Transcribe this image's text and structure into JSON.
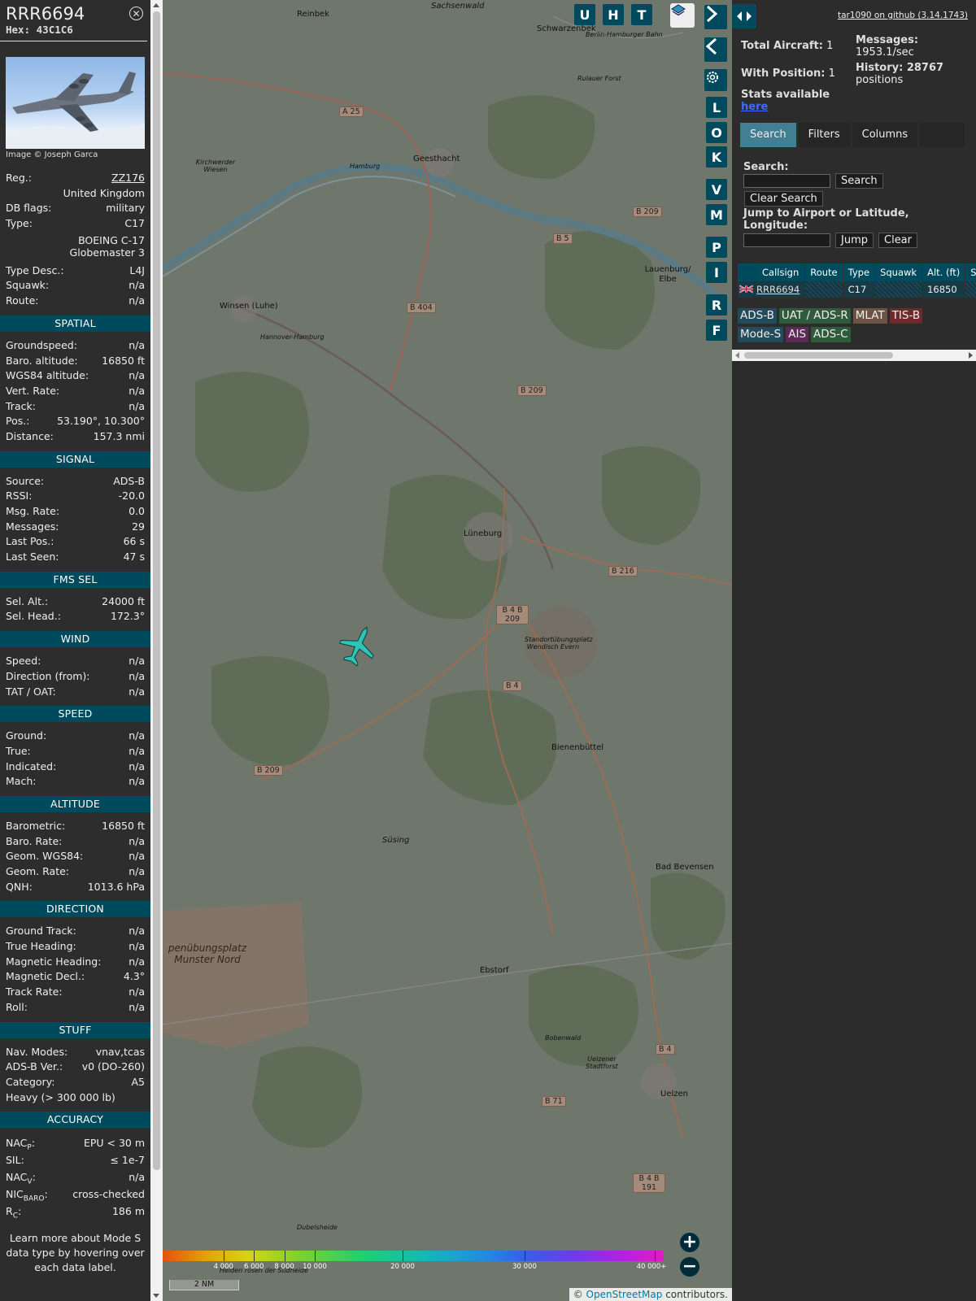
{
  "aircraft": {
    "callsign": "RRR6694",
    "hex_label": "Hex:",
    "hex": "43C1C6",
    "image_credit": "Image © Joseph Garca",
    "reg_label": "Reg.:",
    "reg": "ZZ176",
    "country": "United Kingdom",
    "dbflags_label": "DB flags:",
    "dbflags": "military",
    "type_label": "Type:",
    "type": "C17",
    "type_name_1": "BOEING C-17",
    "type_name_2": "Globemaster 3",
    "typedesc_label": "Type Desc.:",
    "typedesc": "L4J",
    "squawk_label": "Squawk:",
    "squawk": "n/a",
    "route_label": "Route:",
    "route": "n/a"
  },
  "sections": {
    "spatial": "SPATIAL",
    "signal": "SIGNAL",
    "fms": "FMS SEL",
    "wind": "WIND",
    "speed": "SPEED",
    "altitude": "ALTITUDE",
    "direction": "DIRECTION",
    "stuff": "STUFF",
    "accuracy": "ACCURACY"
  },
  "spatial": [
    {
      "label": "Groundspeed:",
      "value": "n/a"
    },
    {
      "label": "Baro. altitude:",
      "value": "16850 ft"
    },
    {
      "label": "WGS84 altitude:",
      "value": "n/a"
    },
    {
      "label": "Vert. Rate:",
      "value": "n/a"
    },
    {
      "label": "Track:",
      "value": "n/a"
    },
    {
      "label": "Pos.:",
      "value": "53.190°, 10.300°"
    },
    {
      "label": "Distance:",
      "value": "157.3 nmi"
    }
  ],
  "signal": [
    {
      "label": "Source:",
      "value": "ADS-B"
    },
    {
      "label": "RSSI:",
      "value": "-20.0"
    },
    {
      "label": "Msg. Rate:",
      "value": "0.0"
    },
    {
      "label": "Messages:",
      "value": "29"
    },
    {
      "label": "Last Pos.:",
      "value": "66 s"
    },
    {
      "label": "Last Seen:",
      "value": "47 s"
    }
  ],
  "fms": [
    {
      "label": "Sel. Alt.:",
      "value": "24000 ft"
    },
    {
      "label": "Sel. Head.:",
      "value": "172.3°"
    }
  ],
  "wind": [
    {
      "label": "Speed:",
      "value": "n/a"
    },
    {
      "label": "Direction (from):",
      "value": "n/a"
    },
    {
      "label": "TAT / OAT:",
      "value": "n/a"
    }
  ],
  "speed": [
    {
      "label": "Ground:",
      "value": "n/a"
    },
    {
      "label": "True:",
      "value": "n/a"
    },
    {
      "label": "Indicated:",
      "value": "n/a"
    },
    {
      "label": "Mach:",
      "value": "n/a"
    }
  ],
  "altitude": [
    {
      "label": "Barometric:",
      "value": "16850 ft"
    },
    {
      "label": "Baro. Rate:",
      "value": "n/a"
    },
    {
      "label": "Geom. WGS84:",
      "value": "n/a"
    },
    {
      "label": "Geom. Rate:",
      "value": "n/a"
    },
    {
      "label": "QNH:",
      "value": "1013.6 hPa"
    }
  ],
  "direction": [
    {
      "label": "Ground Track:",
      "value": "n/a"
    },
    {
      "label": "True Heading:",
      "value": "n/a"
    },
    {
      "label": "Magnetic Heading:",
      "value": "n/a"
    },
    {
      "label": "Magnetic Decl.:",
      "value": "4.3°"
    },
    {
      "label": "Track Rate:",
      "value": "n/a"
    },
    {
      "label": "Roll:",
      "value": "n/a"
    }
  ],
  "stuff": [
    {
      "label": "Nav. Modes:",
      "value": "vnav,tcas"
    },
    {
      "label": "ADS-B Ver.:",
      "value": "v0 (DO-260)"
    },
    {
      "label": "Category:",
      "value": "A5"
    },
    {
      "label": "Heavy (> 300 000 lb)",
      "value": ""
    }
  ],
  "accuracy": [
    {
      "label": "NAC",
      "sub": "P",
      "colon": ":",
      "value": "EPU < 30 m"
    },
    {
      "label": "SIL:",
      "sub": "",
      "colon": "",
      "value": "≤ 1e-7"
    },
    {
      "label": "NAC",
      "sub": "V",
      "colon": ":",
      "value": "n/a"
    },
    {
      "label": "NIC",
      "sub": "BARO",
      "colon": ":",
      "value": "cross-checked"
    },
    {
      "label": "R",
      "sub": "C",
      "colon": ":",
      "value": "186 m"
    }
  ],
  "footer_note": "Learn more about Mode S data type by hovering over each data label.",
  "map": {
    "buttons": [
      "U",
      "H",
      "T",
      "L",
      "O",
      "K",
      "V",
      "M",
      "P",
      "I",
      "R",
      "F"
    ],
    "places": [
      {
        "name": "Reinbek"
      },
      {
        "name": "Sachsenwald"
      },
      {
        "name": "Schwarzenbek"
      },
      {
        "name": "Berlin-Hamburger Bahn"
      },
      {
        "name": "Rulauer Forst"
      },
      {
        "name": "Geesthacht"
      },
      {
        "name": "Kirchwerder Wiesen"
      },
      {
        "name": "Hamburg"
      },
      {
        "name": "Lauenburg/ Elbe"
      },
      {
        "name": "Winsen (Luhe)"
      },
      {
        "name": "Hannover-Hamburg"
      },
      {
        "name": "Lüneburg"
      },
      {
        "name": "Standortübungsplatz Wendisch Evern"
      },
      {
        "name": "Bienenbüttel"
      },
      {
        "name": "Süsing"
      },
      {
        "name": "Bad Bevensen"
      },
      {
        "name": "penübungsplatz Munster Nord"
      },
      {
        "name": "Ebstorf"
      },
      {
        "name": "Bobenwald"
      },
      {
        "name": "Uelzener Stadtforst"
      },
      {
        "name": "Uelzen"
      },
      {
        "name": "Dubelsheide"
      },
      {
        "name": "Heiden rosen der Südheide"
      }
    ],
    "road_labels": [
      "A 25",
      "B 209",
      "B 5",
      "B 404",
      "B 209",
      "B 216",
      "B 4 B 209",
      "B 4",
      "B 209",
      "B 4",
      "B 71",
      "B 4 B 191"
    ],
    "altitude_scale": [
      "4 000",
      "6 000",
      "8 000",
      "10 000",
      "20 000",
      "30 000",
      "40 000+"
    ],
    "altitude_scale_values": [
      4000,
      6000,
      8000,
      10000,
      20000,
      30000,
      40000
    ],
    "scale_bar": "2 NM",
    "attribution_prefix": "© ",
    "attribution_link": "OpenStreetMap",
    "attribution_suffix": " contributors."
  },
  "right": {
    "github_link": "tar1090 on github (3.14.1743)",
    "total_aircraft_label": "Total Aircraft:",
    "total_aircraft": "1",
    "with_position_label": "With Position:",
    "with_position": "1",
    "stats_label": "Stats available",
    "stats_link": "here",
    "messages_label": "Messages:",
    "messages_rate": "1953.1/sec",
    "history_label": "History: 28767",
    "history_unit": "positions",
    "tabs": [
      "Search",
      "Filters",
      "Columns"
    ],
    "search_label": "Search:",
    "search_button": "Search",
    "clear_search_button": "Clear Search",
    "jump_label": "Jump to Airport or Latitude, Longitude:",
    "jump_button": "Jump",
    "clear_button": "Clear",
    "table_headers": [
      "Callsign",
      "Route",
      "Type",
      "Squawk",
      "Alt. (ft)",
      "Spd"
    ],
    "table_rows": [
      {
        "callsign": "RRR6694",
        "route": "",
        "type": "C17",
        "squawk": "",
        "alt": "16850",
        "spd": ""
      }
    ],
    "legend": [
      {
        "label": "ADS-B",
        "color": "#244b5c"
      },
      {
        "label": "UAT / ADS-R",
        "color": "#2f5a3c"
      },
      {
        "label": "MLAT",
        "color": "#6b5443"
      },
      {
        "label": "TIS-B",
        "color": "#6e2a2a"
      },
      {
        "label": "Mode-S",
        "color": "#244b5c"
      },
      {
        "label": "AIS",
        "color": "#5b2a57"
      },
      {
        "label": "ADS-C",
        "color": "#2f5a3c"
      }
    ]
  }
}
